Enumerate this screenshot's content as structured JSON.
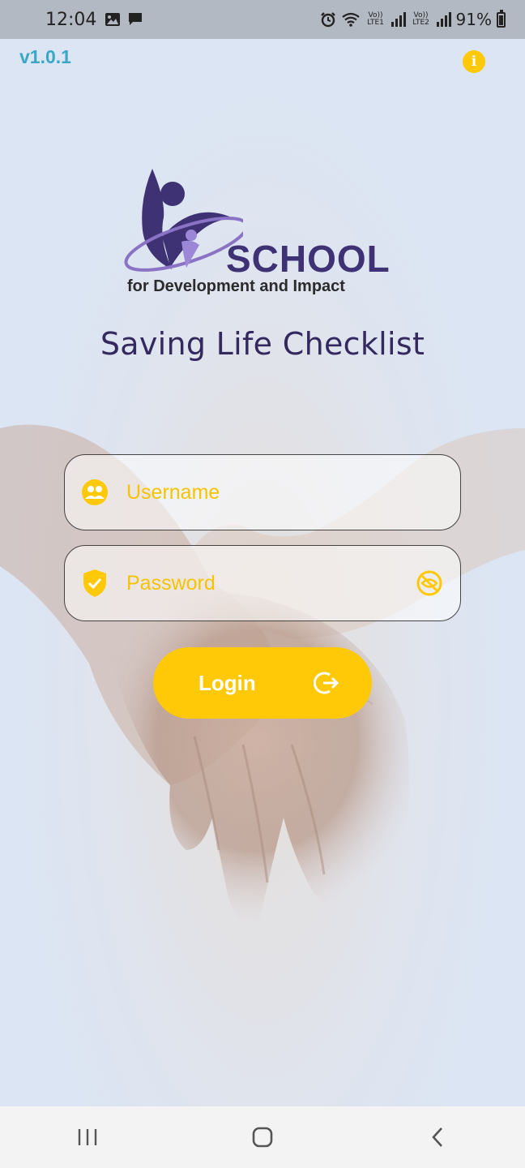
{
  "status_bar": {
    "time": "12:04",
    "sim1": "Vo)) LTE1",
    "sim2": "Vo)) LTE2",
    "battery": "91%"
  },
  "header": {
    "version": "v1.0.1",
    "info_icon": "info-icon"
  },
  "logo": {
    "name": "SCHOOL",
    "tagline": "for Development and Impact"
  },
  "title": "Saving Life Checklist",
  "form": {
    "username_placeholder": "Username",
    "password_placeholder": "Password",
    "login_label": "Login",
    "username_icon": "user-group-icon",
    "password_icon": "shield-check-icon",
    "visibility_icon": "eye-off-icon",
    "login_icon": "logout-arrow-icon"
  },
  "colors": {
    "accent": "#ffc907",
    "brand": "#3e3275",
    "version": "#3aa7c5"
  },
  "nav": {
    "recent": "recent-apps-icon",
    "home": "home-icon",
    "back": "back-icon"
  }
}
